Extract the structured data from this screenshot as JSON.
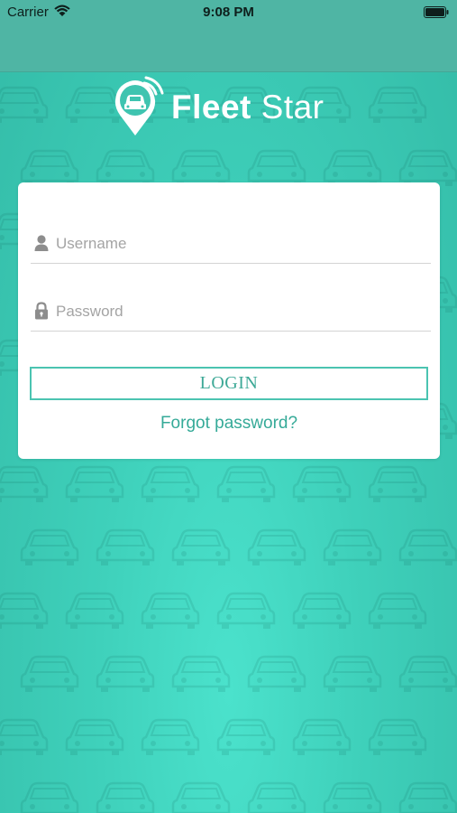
{
  "status_bar": {
    "carrier": "Carrier",
    "time": "9:08 PM",
    "wifi_icon": "wifi-icon",
    "battery_icon": "battery-icon"
  },
  "logo": {
    "icon": "car-location-pin-icon",
    "text_bold": "Fleet",
    "text_light": "Star"
  },
  "login_form": {
    "username": {
      "placeholder": "Username",
      "value": "",
      "icon": "user-icon"
    },
    "password": {
      "placeholder": "Password",
      "value": "",
      "icon": "lock-icon"
    },
    "login_label": "LOGIN",
    "forgot_label": "Forgot password?"
  },
  "colors": {
    "background": "#3fd1bb",
    "navbar": "#4fb5a4",
    "accent": "#4bc4b1",
    "link": "#35aa98",
    "card": "#ffffff"
  }
}
